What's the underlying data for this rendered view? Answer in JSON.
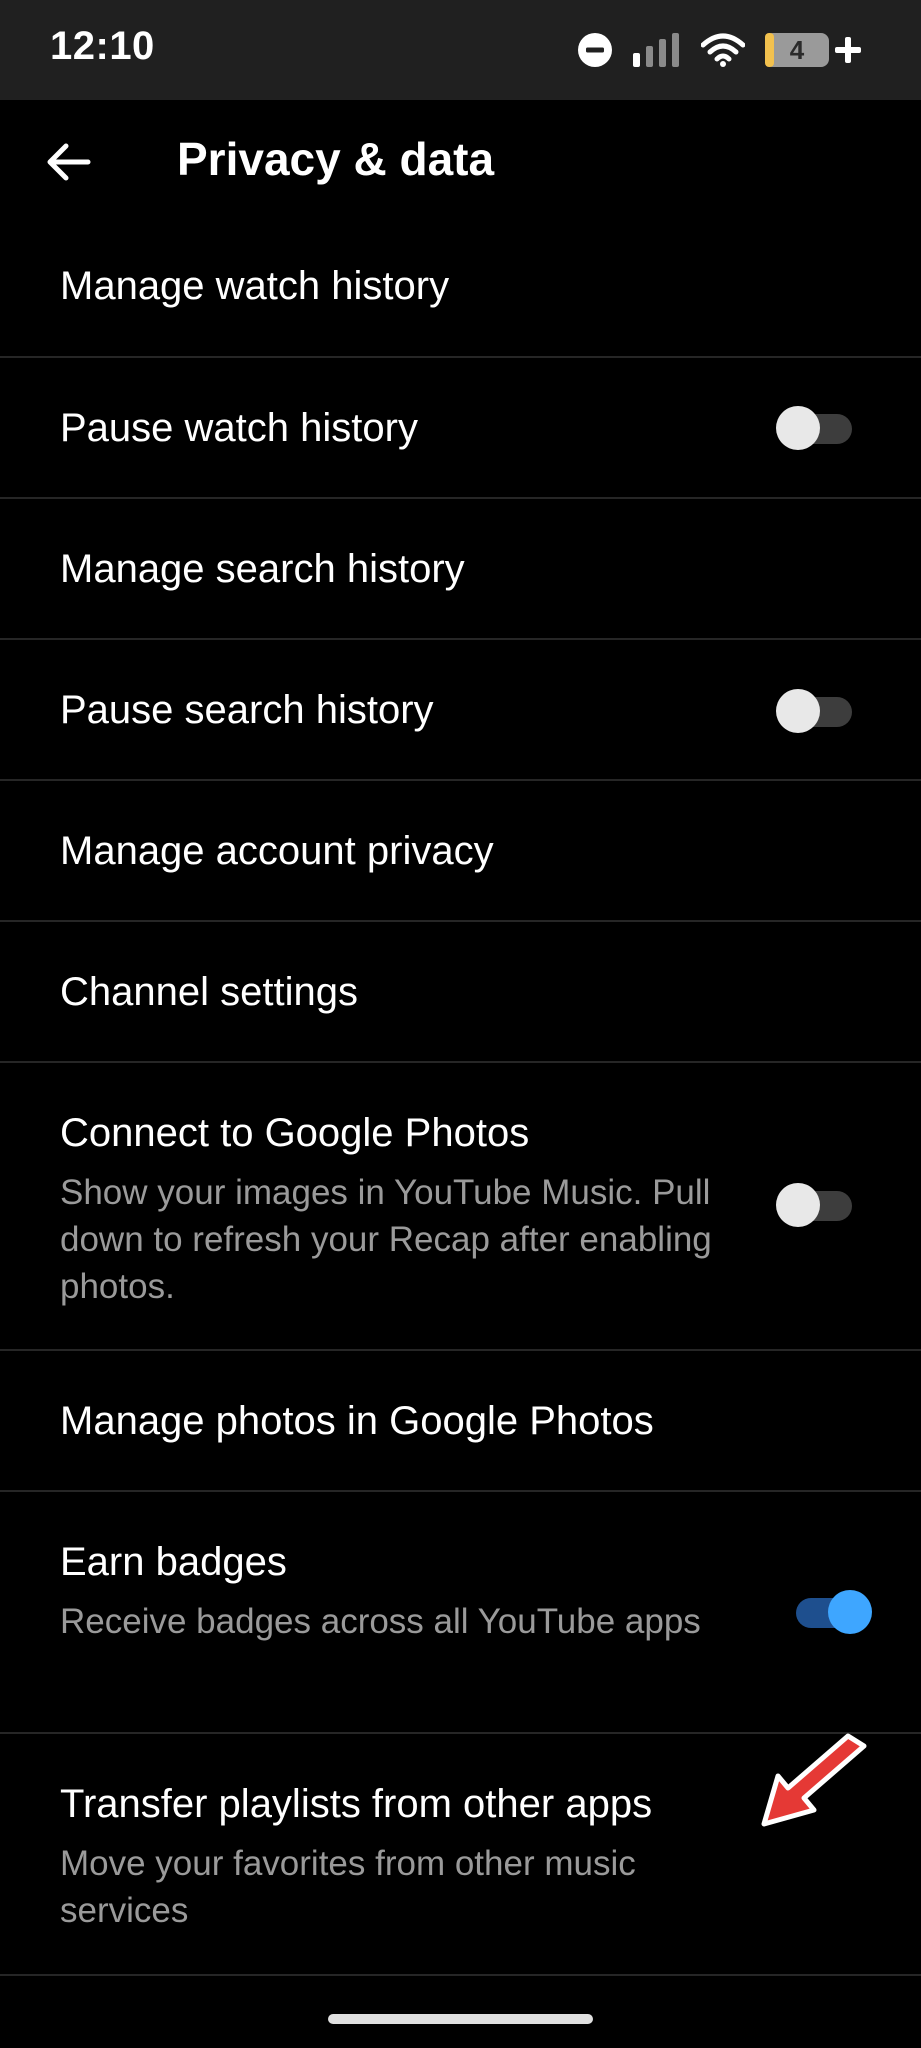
{
  "status_bar": {
    "time": "12:10",
    "battery_level": "4",
    "icons": [
      "do-not-disturb-icon",
      "cellular-signal-icon",
      "wifi-icon",
      "battery-icon",
      "charging-plus-icon"
    ]
  },
  "app_bar": {
    "back_icon": "arrow-left-icon",
    "title": "Privacy & data"
  },
  "settings": {
    "manage_watch_history": {
      "title": "Manage watch history"
    },
    "pause_watch_history": {
      "title": "Pause watch history",
      "toggle_on": false
    },
    "manage_search_history": {
      "title": "Manage search history"
    },
    "pause_search_history": {
      "title": "Pause search history",
      "toggle_on": false
    },
    "manage_account_privacy": {
      "title": "Manage account privacy"
    },
    "channel_settings": {
      "title": "Channel settings"
    },
    "connect_google_photos": {
      "title": "Connect to Google Photos",
      "subtitle": "Show your images in YouTube Music. Pull down to refresh your Recap after enabling photos.",
      "toggle_on": false
    },
    "manage_photos": {
      "title": "Manage photos in Google Photos"
    },
    "earn_badges": {
      "title": "Earn badges",
      "subtitle": "Receive badges across all YouTube apps",
      "toggle_on": true
    },
    "transfer_playlists": {
      "title": "Transfer playlists from other apps",
      "subtitle": "Move your favorites from other music services"
    }
  },
  "colors": {
    "background": "#000000",
    "status_bar": "#202020",
    "divider": "#262626",
    "secondary_text": "#9a9a9a",
    "toggle_on_accent": "#3ea6ff",
    "annotation_arrow": "#e53935"
  }
}
